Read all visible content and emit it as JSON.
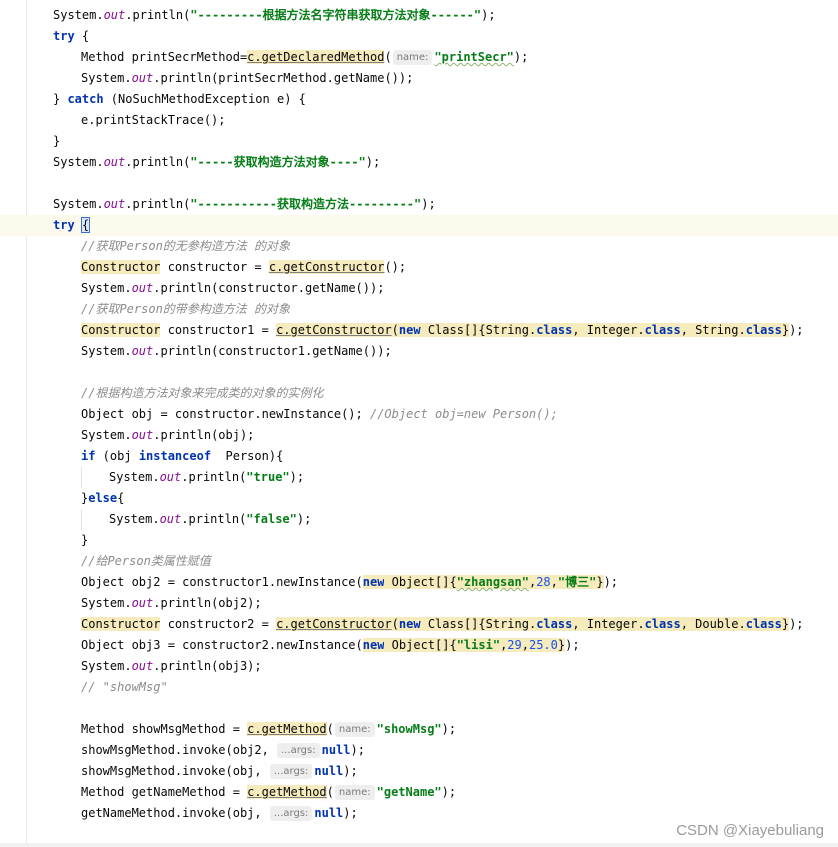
{
  "editor": {
    "lines": [
      {
        "indent": 1,
        "tokens": [
          [
            "System.",
            "p"
          ],
          [
            "out",
            "st"
          ],
          [
            ".println(",
            "p"
          ],
          [
            "\"---------根据方法名字符串获取方法对象------\"",
            "str"
          ],
          [
            ");",
            "p"
          ]
        ]
      },
      {
        "indent": 1,
        "tokens": [
          [
            "try",
            "kw"
          ],
          [
            " {",
            "p"
          ]
        ]
      },
      {
        "indent": 2,
        "tokens": [
          [
            "Method printSecrMethod=",
            "p"
          ],
          [
            "c.getDeclaredMethod",
            "hlu"
          ],
          [
            "(",
            "p"
          ],
          [
            "name:",
            "hint"
          ],
          [
            "\"printSecr\"",
            "str typo"
          ],
          [
            ");",
            "p"
          ]
        ]
      },
      {
        "indent": 2,
        "tokens": [
          [
            "System.",
            "p"
          ],
          [
            "out",
            "st"
          ],
          [
            ".println(printSecrMethod.getName());",
            "p"
          ]
        ]
      },
      {
        "indent": 1,
        "tokens": [
          [
            "} ",
            "p"
          ],
          [
            "catch",
            "kw"
          ],
          [
            " (NoSuchMethodException e) {",
            "p"
          ]
        ]
      },
      {
        "indent": 2,
        "tokens": [
          [
            "e.printStackTrace();",
            "p"
          ]
        ]
      },
      {
        "indent": 1,
        "tokens": [
          [
            "}",
            "p"
          ]
        ]
      },
      {
        "indent": 1,
        "tokens": [
          [
            "System.",
            "p"
          ],
          [
            "out",
            "st"
          ],
          [
            ".println(",
            "p"
          ],
          [
            "\"-----获取构造方法对象----\"",
            "str"
          ],
          [
            ");",
            "p"
          ]
        ]
      },
      {
        "indent": 0,
        "tokens": []
      },
      {
        "indent": 1,
        "tokens": [
          [
            "System.",
            "p"
          ],
          [
            "out",
            "st"
          ],
          [
            ".println(",
            "p"
          ],
          [
            "\"-----------获取构造方法---------\"",
            "str"
          ],
          [
            ");",
            "p"
          ]
        ]
      },
      {
        "indent": 1,
        "current": true,
        "tokens": [
          [
            "try",
            "kw"
          ],
          [
            " ",
            "p"
          ],
          [
            "{",
            "caret-box"
          ]
        ]
      },
      {
        "indent": 2,
        "tokens": [
          [
            "//获取Person的无参构造方法 的对象",
            "cm"
          ]
        ]
      },
      {
        "indent": 2,
        "tokens": [
          [
            "Constructor",
            "hl"
          ],
          [
            " constructor = ",
            "p"
          ],
          [
            "c.getConstructor",
            "hlu"
          ],
          [
            "();",
            "p"
          ]
        ]
      },
      {
        "indent": 2,
        "tokens": [
          [
            "System.",
            "p"
          ],
          [
            "out",
            "st"
          ],
          [
            ".println(constructor.getName());",
            "p"
          ]
        ]
      },
      {
        "indent": 2,
        "tokens": [
          [
            "//获取Person的带参构造方法 的对象",
            "cm"
          ]
        ]
      },
      {
        "indent": 2,
        "tokens": [
          [
            "Constructor",
            "hl"
          ],
          [
            " constructor1 = ",
            "p"
          ],
          [
            "c.getConstructor",
            "hlu"
          ],
          [
            "(",
            "hl"
          ],
          [
            "new",
            "kw hl"
          ],
          [
            " Class[]{String.",
            "hl"
          ],
          [
            "class",
            "kw hl"
          ],
          [
            ", Integer.",
            "hl"
          ],
          [
            "class",
            "kw hl"
          ],
          [
            ", String.",
            "hl"
          ],
          [
            "class",
            "kw hl"
          ],
          [
            "}",
            "hl"
          ],
          [
            ");",
            "p"
          ]
        ]
      },
      {
        "indent": 2,
        "tokens": [
          [
            "System.",
            "p"
          ],
          [
            "out",
            "st"
          ],
          [
            ".println(constructor1.getName());",
            "p"
          ]
        ]
      },
      {
        "indent": 0,
        "tokens": []
      },
      {
        "indent": 2,
        "tokens": [
          [
            "//根据构造方法对象来完成类的对象的实例化",
            "cm"
          ]
        ]
      },
      {
        "indent": 2,
        "tokens": [
          [
            "Object obj = constructor.newInstance(); ",
            "p"
          ],
          [
            "//Object obj=new Person();",
            "cm"
          ]
        ]
      },
      {
        "indent": 2,
        "tokens": [
          [
            "System.",
            "p"
          ],
          [
            "out",
            "st"
          ],
          [
            ".println(obj);",
            "p"
          ]
        ]
      },
      {
        "indent": 2,
        "tokens": [
          [
            "if",
            "kw"
          ],
          [
            " (obj ",
            "p"
          ],
          [
            "instanceof",
            "kw"
          ],
          [
            "  Person){",
            "p"
          ]
        ]
      },
      {
        "indent": 3,
        "tokens": [
          [
            "System.",
            "p"
          ],
          [
            "out",
            "st"
          ],
          [
            ".println(",
            "p"
          ],
          [
            "\"true\"",
            "str"
          ],
          [
            ");",
            "p"
          ]
        ]
      },
      {
        "indent": 2,
        "tokens": [
          [
            "}",
            "p"
          ],
          [
            "else",
            "kw"
          ],
          [
            "{",
            "p"
          ]
        ]
      },
      {
        "indent": 3,
        "tokens": [
          [
            "System.",
            "p"
          ],
          [
            "out",
            "st"
          ],
          [
            ".println(",
            "p"
          ],
          [
            "\"false\"",
            "str"
          ],
          [
            ");",
            "p"
          ]
        ]
      },
      {
        "indent": 2,
        "tokens": [
          [
            "}",
            "p"
          ]
        ]
      },
      {
        "indent": 2,
        "tokens": [
          [
            "//给Person类属性赋值",
            "cm"
          ]
        ]
      },
      {
        "indent": 2,
        "tokens": [
          [
            "Object obj2 = constructor1.newInstance(",
            "p"
          ],
          [
            "new",
            "kw hl"
          ],
          [
            " Object[]{",
            "hl"
          ],
          [
            "\"zhangsan\"",
            "str typo hl"
          ],
          [
            ",",
            "hl"
          ],
          [
            "28",
            "num hl"
          ],
          [
            ",",
            "hl"
          ],
          [
            "\"博三\"",
            "str hl"
          ],
          [
            "}",
            "hl"
          ],
          [
            ");",
            "p"
          ]
        ]
      },
      {
        "indent": 2,
        "tokens": [
          [
            "System.",
            "p"
          ],
          [
            "out",
            "st"
          ],
          [
            ".println(obj2);",
            "p"
          ]
        ]
      },
      {
        "indent": 2,
        "tokens": [
          [
            "Constructor",
            "hl"
          ],
          [
            " constructor2 = ",
            "p"
          ],
          [
            "c.getConstructor",
            "hlu"
          ],
          [
            "(",
            "hl"
          ],
          [
            "new",
            "kw hl"
          ],
          [
            " Class[]{String.",
            "hl"
          ],
          [
            "class",
            "kw hl"
          ],
          [
            ", Integer.",
            "hl"
          ],
          [
            "class",
            "kw hl"
          ],
          [
            ", Double.",
            "hl"
          ],
          [
            "class",
            "kw hl"
          ],
          [
            "}",
            "hl"
          ],
          [
            ");",
            "p"
          ]
        ]
      },
      {
        "indent": 2,
        "tokens": [
          [
            "Object obj3 = constructor2.newInstance(",
            "p"
          ],
          [
            "new",
            "kw hl"
          ],
          [
            " Object[]{",
            "hl"
          ],
          [
            "\"lisi\"",
            "str hl"
          ],
          [
            ",",
            "hl"
          ],
          [
            "29",
            "num hl"
          ],
          [
            ",",
            "hl"
          ],
          [
            "25.0",
            "num hl"
          ],
          [
            "}",
            "hl"
          ],
          [
            ");",
            "p"
          ]
        ]
      },
      {
        "indent": 2,
        "tokens": [
          [
            "System.",
            "p"
          ],
          [
            "out",
            "st"
          ],
          [
            ".println(obj3);",
            "p"
          ]
        ]
      },
      {
        "indent": 2,
        "tokens": [
          [
            "// \"showMsg\"",
            "cm"
          ]
        ]
      },
      {
        "indent": 0,
        "tokens": []
      },
      {
        "indent": 2,
        "tokens": [
          [
            "Method showMsgMethod = ",
            "p"
          ],
          [
            "c.getMethod",
            "hlu"
          ],
          [
            "(",
            "p"
          ],
          [
            "name:",
            "hint"
          ],
          [
            "\"showMsg\"",
            "str"
          ],
          [
            ");",
            "p"
          ]
        ]
      },
      {
        "indent": 2,
        "tokens": [
          [
            "showMsgMethod.invoke(obj2, ",
            "p"
          ],
          [
            "...args:",
            "hint"
          ],
          [
            "null",
            "kw"
          ],
          [
            ");",
            "p"
          ]
        ]
      },
      {
        "indent": 2,
        "tokens": [
          [
            "showMsgMethod.invoke(obj, ",
            "p"
          ],
          [
            "...args:",
            "hint"
          ],
          [
            "null",
            "kw"
          ],
          [
            ");",
            "p"
          ]
        ]
      },
      {
        "indent": 2,
        "tokens": [
          [
            "Method getNameMethod = ",
            "p"
          ],
          [
            "c.getMethod",
            "hlu"
          ],
          [
            "(",
            "p"
          ],
          [
            "name:",
            "hint"
          ],
          [
            "\"getName\"",
            "str"
          ],
          [
            ");",
            "p"
          ]
        ]
      },
      {
        "indent": 2,
        "tokens": [
          [
            "getNameMethod.invoke(obj, ",
            "p"
          ],
          [
            "...args:",
            "hint"
          ],
          [
            "null",
            "kw"
          ],
          [
            ");",
            "p"
          ]
        ]
      }
    ]
  },
  "watermark": "CSDN @Xiayebuliang"
}
